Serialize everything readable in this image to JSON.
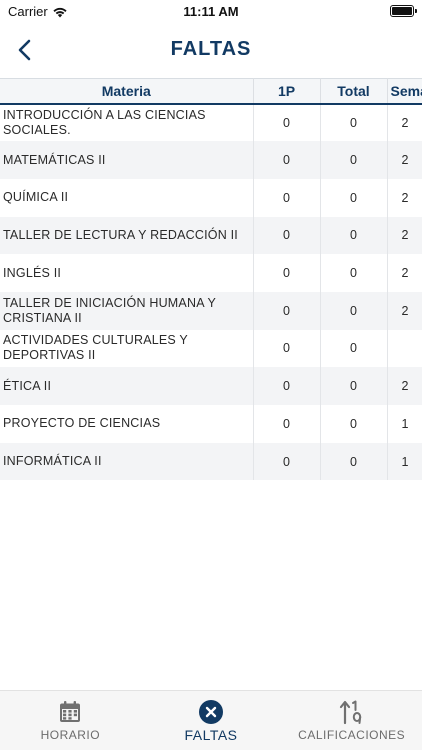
{
  "status_bar": {
    "carrier": "Carrier",
    "time": "11:11 AM"
  },
  "header": {
    "title": "FALTAS"
  },
  "table": {
    "columns": [
      "Materia",
      "1P",
      "Total",
      "Sema"
    ],
    "rows": [
      {
        "materia": "INTRODUCCIÓN A LAS CIENCIAS SOCIALES.",
        "p1": "0",
        "total": "0",
        "semana": "2"
      },
      {
        "materia": "MATEMÁTICAS II",
        "p1": "0",
        "total": "0",
        "semana": "2"
      },
      {
        "materia": "QUÍMICA II",
        "p1": "0",
        "total": "0",
        "semana": "2"
      },
      {
        "materia": "TALLER DE LECTURA Y REDACCIÓN II",
        "p1": "0",
        "total": "0",
        "semana": "2"
      },
      {
        "materia": "INGLÉS II",
        "p1": "0",
        "total": "0",
        "semana": "2"
      },
      {
        "materia": "TALLER DE INICIACIÓN HUMANA Y CRISTIANA II",
        "p1": "0",
        "total": "0",
        "semana": "2"
      },
      {
        "materia": "ACTIVIDADES CULTURALES Y DEPORTIVAS II",
        "p1": "0",
        "total": "0",
        "semana": ""
      },
      {
        "materia": "ÉTICA II",
        "p1": "0",
        "total": "0",
        "semana": "2"
      },
      {
        "materia": "PROYECTO DE CIENCIAS",
        "p1": "0",
        "total": "0",
        "semana": "1"
      },
      {
        "materia": "INFORMÁTICA II",
        "p1": "0",
        "total": "0",
        "semana": "1"
      }
    ]
  },
  "tabs": [
    {
      "label": "HORARIO",
      "icon": "calendar-icon",
      "active": false
    },
    {
      "label": "FALTAS",
      "icon": "x-circle-icon",
      "active": true
    },
    {
      "label": "CALIFICACIONES",
      "icon": "sort-numeric-icon",
      "active": false
    }
  ],
  "colors": {
    "primary": "#123a63",
    "inactive": "#6c6c6c",
    "tab_bar_bg": "#f6f6f6"
  }
}
